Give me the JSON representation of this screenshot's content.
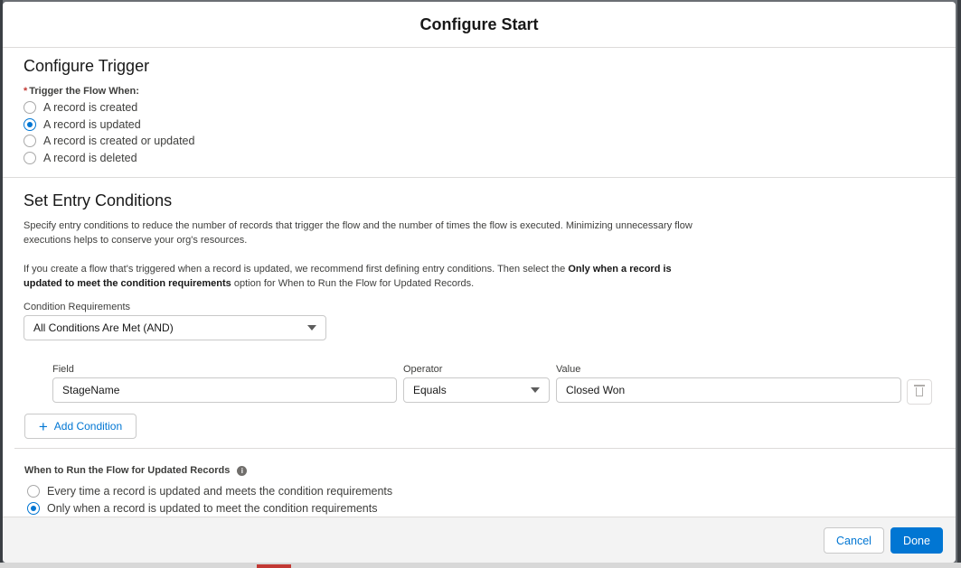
{
  "modal": {
    "title": "Configure Start"
  },
  "trigger": {
    "section_title": "Configure Trigger",
    "required_mark": "*",
    "label": "Trigger the Flow When:",
    "options": [
      {
        "label": "A record is created",
        "checked": false
      },
      {
        "label": "A record is updated",
        "checked": true
      },
      {
        "label": "A record is created or updated",
        "checked": false
      },
      {
        "label": "A record is deleted",
        "checked": false
      }
    ]
  },
  "entry": {
    "section_title": "Set Entry Conditions",
    "desc1": "Specify entry conditions to reduce the number of records that trigger the flow and the number of times the flow is executed. Minimizing unnecessary flow executions helps to conserve your org's resources.",
    "desc2_pre": "If you create a flow that's triggered when a record is updated, we recommend first defining entry conditions. Then select the ",
    "desc2_bold": "Only when a record is updated to meet the condition requirements",
    "desc2_post": " option for When to Run the Flow for Updated Records.",
    "condition_requirements_label": "Condition Requirements",
    "condition_requirements_value": "All Conditions Are Met (AND)",
    "condition": {
      "field_label": "Field",
      "field_value": "StageName",
      "operator_label": "Operator",
      "operator_value": "Equals",
      "value_label": "Value",
      "value_value": "Closed Won"
    },
    "add_condition_label": "Add Condition"
  },
  "when_to_run": {
    "title": "When to Run the Flow for Updated Records",
    "info_glyph": "i",
    "options": [
      {
        "label": "Every time a record is updated and meets the condition requirements",
        "checked": false
      },
      {
        "label": "Only when a record is updated to meet the condition requirements",
        "checked": true
      }
    ]
  },
  "footer": {
    "cancel_label": "Cancel",
    "done_label": "Done"
  },
  "colors": {
    "brand": "#0176d3",
    "required": "#c23934",
    "border": "#c9c9c9"
  }
}
